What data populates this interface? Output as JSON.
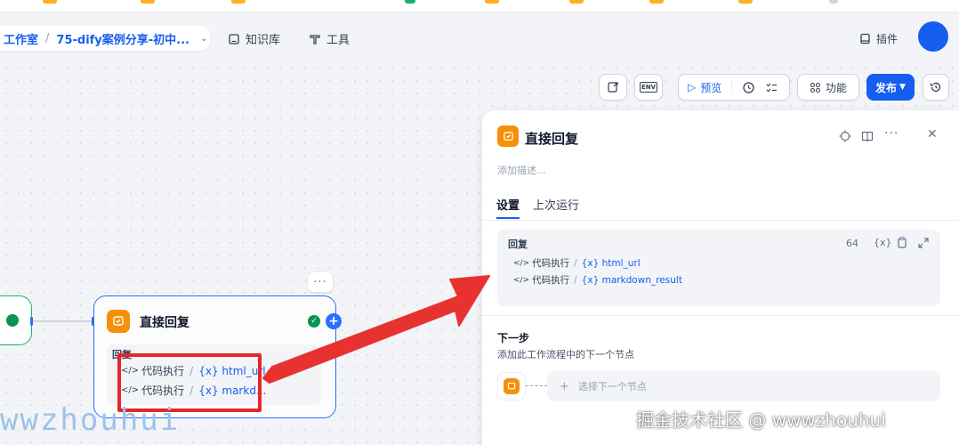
{
  "colors": {
    "accent": "#155eef",
    "answer_node": "#f79009",
    "success": "#079455",
    "highlight": "#e5262b"
  },
  "breadcrumb": {
    "studio": "工作室",
    "separator": "/",
    "app_name": "75-dify案例分享-初中..."
  },
  "nav": {
    "knowledge": "知识库",
    "tools": "工具",
    "plugins": "插件"
  },
  "toolbar": {
    "env_label": "ENV",
    "preview": "预览",
    "features": "功能",
    "publish": "发布"
  },
  "node": {
    "title": "直接回复",
    "more": "···",
    "body_label": "回复",
    "vars": [
      {
        "source": "代码执行",
        "var": "{x} html_url"
      },
      {
        "source": "代码执行",
        "var": "{x} markd..."
      }
    ]
  },
  "panel": {
    "title": "直接回复",
    "description_placeholder": "添加描述...",
    "tabs": [
      "设置",
      "上次运行"
    ],
    "reply_label": "回复",
    "char_count": "64",
    "var_insert": "{x}",
    "vars": [
      {
        "source": "代码执行",
        "var": "{x} html_url"
      },
      {
        "source": "代码执行",
        "var": "{x} markdown_result"
      }
    ],
    "next_step_title": "下一步",
    "next_step_desc": "添加此工作流程中的下一个节点",
    "select_next": "选择下一个节点"
  },
  "watermarks": {
    "left": "wwzhouhui",
    "right": "掘金技术社区 @ wwwzhouhui"
  }
}
